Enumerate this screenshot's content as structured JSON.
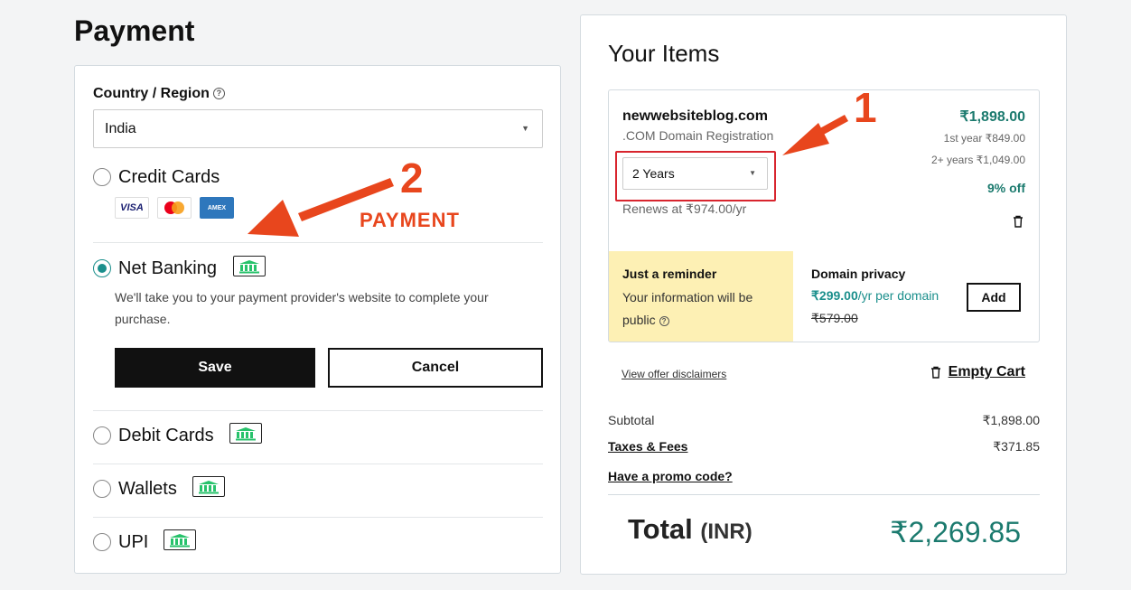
{
  "page": {
    "title": "Payment"
  },
  "payment": {
    "country_label": "Country / Region",
    "country_value": "India",
    "options": {
      "credit_cards": "Credit Cards",
      "net_banking": "Net Banking",
      "debit_cards": "Debit Cards",
      "wallets": "Wallets",
      "upi": "UPI"
    },
    "cards": {
      "visa": "VISA",
      "amex": "AMEX"
    },
    "selected_option": "net_banking",
    "net_banking_description": "We'll take you to your payment provider's website to complete your purchase.",
    "save_label": "Save",
    "cancel_label": "Cancel"
  },
  "annotations": {
    "step1": "1",
    "step2": "2",
    "payment_text": "PAYMENT",
    "color": "#e8461d"
  },
  "cart": {
    "title": "Your Items",
    "item": {
      "domain": "newwebsiteblog.com",
      "type": ".COM Domain Registration",
      "term": "2 Years",
      "renews": "Renews at ₹974.00/yr",
      "price": "₹1,898.00",
      "first_year": "1st year ₹849.00",
      "later_years": "2+ years ₹1,049.00",
      "discount": "9% off"
    },
    "reminder": {
      "title": "Just a reminder",
      "text": "Your information will be public"
    },
    "privacy": {
      "title": "Domain privacy",
      "price": "₹299.00",
      "price_suffix": "/yr per domain",
      "old_price": "₹579.00",
      "add_label": "Add"
    },
    "disclaimers": "View offer disclaimers",
    "empty_cart": "Empty Cart",
    "subtotal_label": "Subtotal",
    "subtotal_value": "₹1,898.00",
    "taxes_label": "Taxes & Fees",
    "taxes_value": "₹371.85",
    "promo_label": "Have a promo code?",
    "total_label": "Total",
    "total_currency": "(INR)",
    "total_value": "₹2,269.85"
  },
  "colors": {
    "accent": "#1b8f8c",
    "price_green": "#1b7a6e",
    "reminder_bg": "#fdf0b4",
    "highlight_red": "#d8252e"
  }
}
